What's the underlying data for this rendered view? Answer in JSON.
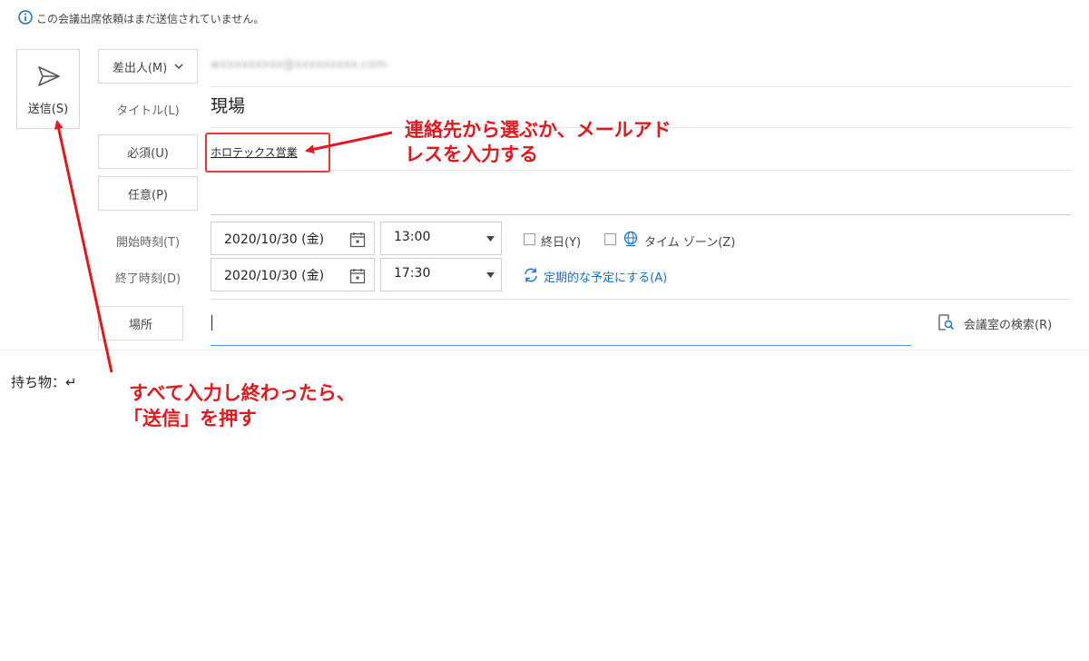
{
  "info_bar": {
    "message": "この会議出席依頼はまだ送信されていません。",
    "icon": "info-icon"
  },
  "send": {
    "label": "送信(S)",
    "icon": "paper-plane-icon"
  },
  "from": {
    "label": "差出人(M)",
    "email": "wxxxxxxxxx@xxxxxxxxx.com"
  },
  "title": {
    "label": "タイトル(L)",
    "value": "現場"
  },
  "required": {
    "label": "必須(U)",
    "value": "ホロテックス営業"
  },
  "optional": {
    "label": "任意(P)",
    "value": ""
  },
  "start": {
    "label": "開始時刻(T)",
    "date": "2020/10/30 (金)",
    "time": "13:00"
  },
  "end": {
    "label": "終了時刻(D)",
    "date": "2020/10/30 (金)",
    "time": "17:30"
  },
  "all_day": {
    "label": "終日(Y)"
  },
  "time_zone": {
    "label": "タイム ゾーン(Z)"
  },
  "recurrence": {
    "label": "定期的な予定にする(A)"
  },
  "location": {
    "label": "場所",
    "value": ""
  },
  "room_finder": {
    "label": "会議室の検索(R)"
  },
  "body": {
    "text": "持ち物：↵"
  },
  "annotations": {
    "address": {
      "line1": "連絡先から選ぶか、メールアド",
      "line2": "レスを入力する"
    },
    "send": {
      "line1": "すべて入力し終わったら、",
      "line2": "「送信」を押す"
    }
  },
  "colors": {
    "annotation_red": "#e0191f",
    "link_blue": "#1a6ec8",
    "focus_blue": "#4a8fd0"
  }
}
